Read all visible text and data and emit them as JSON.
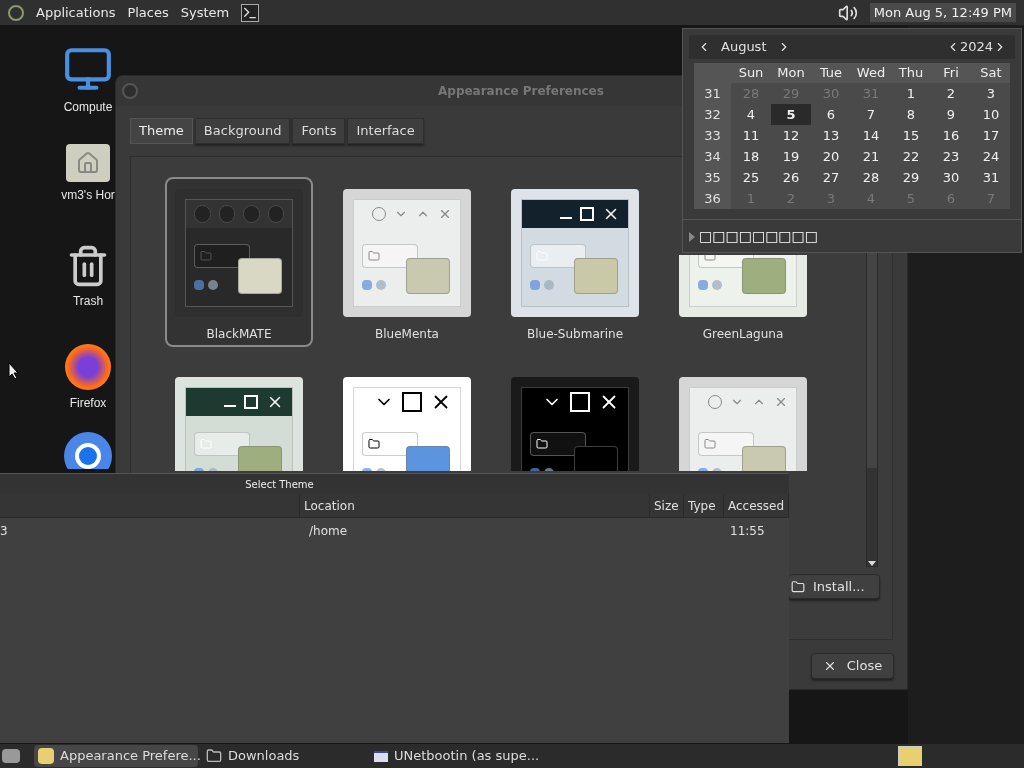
{
  "top_panel": {
    "menus": [
      {
        "label": "Applications"
      },
      {
        "label": "Places"
      },
      {
        "label": "System"
      }
    ],
    "clock": "Mon Aug 5, 12:49 PM"
  },
  "desktop_icons": [
    {
      "kind": "computer",
      "label": "Compute"
    },
    {
      "kind": "home",
      "label": "vm3's Hor"
    },
    {
      "kind": "trash",
      "label": "Trash"
    },
    {
      "kind": "firefox",
      "label": "Firefox"
    },
    {
      "kind": "chrome"
    }
  ],
  "appearance_window": {
    "title": "Appearance Preferences",
    "tabs": [
      {
        "label": "Theme",
        "selected": true
      },
      {
        "label": "Background",
        "selected": false
      },
      {
        "label": "Fonts",
        "selected": false
      },
      {
        "label": "Interface",
        "selected": false
      }
    ],
    "themes": [
      {
        "kind": "blackmate",
        "name": "BlackMATE",
        "selected": true
      },
      {
        "kind": "bluementa",
        "name": "BlueMenta",
        "selected": false
      },
      {
        "kind": "submarine",
        "name": "Blue-Submarine",
        "selected": false
      },
      {
        "kind": "greenlaguna",
        "name": "GreenLaguna",
        "selected": false
      },
      {
        "kind": "submarine-green",
        "selected": false
      },
      {
        "kind": "contrast-white",
        "selected": false
      },
      {
        "kind": "contrast-black",
        "selected": false
      },
      {
        "kind": "bluementa",
        "selected": false
      }
    ],
    "install_button": "Install...",
    "close_button": "Close"
  },
  "calendar": {
    "month": "August",
    "year": "2024",
    "weekdays": [
      "Sun",
      "Mon",
      "Tue",
      "Wed",
      "Thu",
      "Fri",
      "Sat"
    ],
    "weeks": [
      {
        "number": "31",
        "days": [
          {
            "label": "28",
            "other_month": true,
            "selected": false
          },
          {
            "label": "29",
            "other_month": true,
            "selected": false
          },
          {
            "label": "30",
            "other_month": true,
            "selected": false
          },
          {
            "label": "31",
            "other_month": true,
            "selected": false
          },
          {
            "label": "1",
            "other_month": false,
            "selected": false
          },
          {
            "label": "2",
            "other_month": false,
            "selected": false
          },
          {
            "label": "3",
            "other_month": false,
            "selected": false
          }
        ]
      },
      {
        "number": "32",
        "days": [
          {
            "label": "4",
            "other_month": false,
            "selected": false
          },
          {
            "label": "5",
            "other_month": false,
            "selected": true
          },
          {
            "label": "6",
            "other_month": false,
            "selected": false
          },
          {
            "label": "7",
            "other_month": false,
            "selected": false
          },
          {
            "label": "8",
            "other_month": false,
            "selected": false
          },
          {
            "label": "9",
            "other_month": false,
            "selected": false
          },
          {
            "label": "10",
            "other_month": false,
            "selected": false
          }
        ]
      },
      {
        "number": "33",
        "days": [
          {
            "label": "11",
            "other_month": false,
            "selected": false
          },
          {
            "label": "12",
            "other_month": false,
            "selected": false
          },
          {
            "label": "13",
            "other_month": false,
            "selected": false
          },
          {
            "label": "14",
            "other_month": false,
            "selected": false
          },
          {
            "label": "15",
            "other_month": false,
            "selected": false
          },
          {
            "label": "16",
            "other_month": false,
            "selected": false
          },
          {
            "label": "17",
            "other_month": false,
            "selected": false
          }
        ]
      },
      {
        "number": "34",
        "days": [
          {
            "label": "18",
            "other_month": false,
            "selected": false
          },
          {
            "label": "19",
            "other_month": false,
            "selected": false
          },
          {
            "label": "20",
            "other_month": false,
            "selected": false
          },
          {
            "label": "21",
            "other_month": false,
            "selected": false
          },
          {
            "label": "22",
            "other_month": false,
            "selected": false
          },
          {
            "label": "23",
            "other_month": false,
            "selected": false
          },
          {
            "label": "24",
            "other_month": false,
            "selected": false
          }
        ]
      },
      {
        "number": "35",
        "days": [
          {
            "label": "25",
            "other_month": false,
            "selected": false
          },
          {
            "label": "26",
            "other_month": false,
            "selected": false
          },
          {
            "label": "27",
            "other_month": false,
            "selected": false
          },
          {
            "label": "28",
            "other_month": false,
            "selected": false
          },
          {
            "label": "29",
            "other_month": false,
            "selected": false
          },
          {
            "label": "30",
            "other_month": false,
            "selected": false
          },
          {
            "label": "31",
            "other_month": false,
            "selected": false
          }
        ]
      },
      {
        "number": "36",
        "days": [
          {
            "label": "1",
            "other_month": true,
            "selected": false
          },
          {
            "label": "2",
            "other_month": true,
            "selected": false
          },
          {
            "label": "3",
            "other_month": true,
            "selected": false
          },
          {
            "label": "4",
            "other_month": true,
            "selected": false
          },
          {
            "label": "5",
            "other_month": true,
            "selected": false
          },
          {
            "label": "6",
            "other_month": true,
            "selected": false
          },
          {
            "label": "7",
            "other_month": true,
            "selected": false
          }
        ]
      }
    ],
    "expander_label": "□□□□□□□□□",
    "expanded": false
  },
  "file_chooser": {
    "title": "Select Theme",
    "columns": [
      {
        "label": "Location"
      },
      {
        "label": "Size"
      },
      {
        "label": "Type"
      },
      {
        "label": "Accessed"
      }
    ],
    "rows": [
      {
        "column_1": "3",
        "location": "/home",
        "accessed": "11:55"
      }
    ]
  },
  "taskbar": {
    "tasks": [
      {
        "kind": "appearance",
        "label": "Appearance Prefere...",
        "selected": true
      },
      {
        "kind": "folder",
        "label": "Downloads",
        "selected": false
      },
      {
        "kind": "window",
        "label": "UNetbootin (as supe...",
        "selected": false
      }
    ]
  }
}
